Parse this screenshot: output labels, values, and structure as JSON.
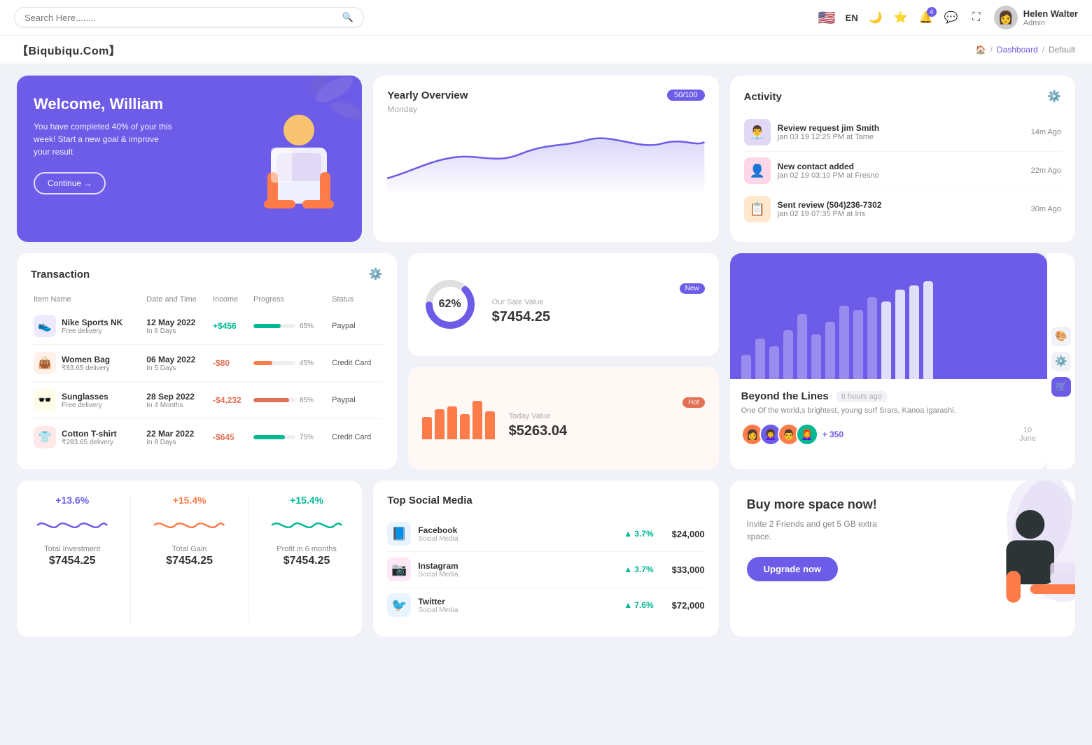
{
  "topnav": {
    "search_placeholder": "Search Here........",
    "language": "EN",
    "user": {
      "name": "Helen Walter",
      "role": "Admin"
    }
  },
  "breadcrumb": {
    "brand": "【Biqubiqu.Com】",
    "home": "Home",
    "dashboard": "Dashboard",
    "current": "Default"
  },
  "welcome": {
    "title": "Welcome, William",
    "subtitle": "You have completed 40% of your this week! Start a new goal & improve your result",
    "button": "Continue →"
  },
  "yearly": {
    "title": "Yearly Overview",
    "day": "Monday",
    "badge": "50/100"
  },
  "activity": {
    "title": "Activity",
    "items": [
      {
        "name": "Review request jim Smith",
        "sub": "jan 03 19 12:25 PM at Tame",
        "time": "14m Ago"
      },
      {
        "name": "New contact added",
        "sub": "jan 02 19 03:10 PM at Fresno",
        "time": "22m Ago"
      },
      {
        "name": "Sent review (504)236-7302",
        "sub": "jan 02 19 07:35 PM at Iris",
        "time": "30m Ago"
      }
    ]
  },
  "transaction": {
    "title": "Transaction",
    "columns": [
      "Item Name",
      "Date and Time",
      "Income",
      "Progress",
      "Status"
    ],
    "rows": [
      {
        "icon": "👟",
        "icon_bg": "#ede9ff",
        "name": "Nike Sports NK",
        "sub": "Free delivery",
        "date": "12 May 2022",
        "date_sub": "In 6 Days",
        "income": "+$456",
        "income_type": "pos",
        "progress": 65,
        "progress_color": "#00b894",
        "status": "Paypal"
      },
      {
        "icon": "👜",
        "icon_bg": "#fff0ea",
        "name": "Women Bag",
        "sub": "₹83.65 delivery",
        "date": "06 May 2022",
        "date_sub": "In 5 Days",
        "income": "-$80",
        "income_type": "neg",
        "progress": 45,
        "progress_color": "#fd7c4a",
        "status": "Credit Card"
      },
      {
        "icon": "🕶️",
        "icon_bg": "#fffde7",
        "name": "Sunglasses",
        "sub": "Free delivery",
        "date": "28 Sep 2022",
        "date_sub": "In 4 Months",
        "income": "-$4,232",
        "income_type": "neg",
        "progress": 85,
        "progress_color": "#e17055",
        "status": "Paypal"
      },
      {
        "icon": "👕",
        "icon_bg": "#ffe8e8",
        "name": "Cotton T-shirt",
        "sub": "₹283.65 delivery",
        "date": "22 Mar 2022",
        "date_sub": "In 8 Days",
        "income": "-$645",
        "income_type": "neg",
        "progress": 75,
        "progress_color": "#00b894",
        "status": "Credit Card"
      }
    ]
  },
  "sale_value": {
    "donut_pct": "62%",
    "donut_value": 62,
    "label": "Our Sale Value",
    "amount": "$7454.25",
    "badge": "New"
  },
  "today_value": {
    "label": "Today Value",
    "amount": "$5263.04",
    "badge": "Hot",
    "bars": [
      40,
      55,
      60,
      45,
      70,
      50
    ]
  },
  "beyond": {
    "title": "Beyond the Lines",
    "time": "6 hours ago",
    "desc": "One Of the world,s brightest, young surf Srars, Kanoa Igarashi.",
    "avatar_extra": "+ 350",
    "date_num": "10",
    "date_month": "June",
    "bars": [
      30,
      50,
      40,
      60,
      80,
      55,
      70,
      90,
      85,
      100,
      95,
      110,
      115,
      120
    ]
  },
  "stats": [
    {
      "pct": "+13.6%",
      "color": "blue",
      "label": "Total Investment",
      "value": "$7454.25"
    },
    {
      "pct": "+15.4%",
      "color": "orange",
      "label": "Total Gain",
      "value": "$7454.25"
    },
    {
      "pct": "+15.4%",
      "color": "green",
      "label": "Profit in 6 months",
      "value": "$7454.25"
    }
  ],
  "social": {
    "title": "Top Social Media",
    "items": [
      {
        "name": "Facebook",
        "sub": "Social Media",
        "icon": "📘",
        "icon_bg": "#e8f4ff",
        "change": "3.7%",
        "amount": "$24,000"
      },
      {
        "name": "Instagram",
        "sub": "Social Media",
        "icon": "📷",
        "icon_bg": "#ffe8f5",
        "change": "3.7%",
        "amount": "$33,000"
      },
      {
        "name": "Twitter",
        "sub": "Social Media",
        "icon": "🐦",
        "icon_bg": "#e8f4ff",
        "change": "7.6%",
        "amount": "$72,000"
      }
    ]
  },
  "space": {
    "title": "Buy more space now!",
    "desc": "Invite 2 Friends and get 5 GB extra space.",
    "button": "Upgrade now"
  }
}
